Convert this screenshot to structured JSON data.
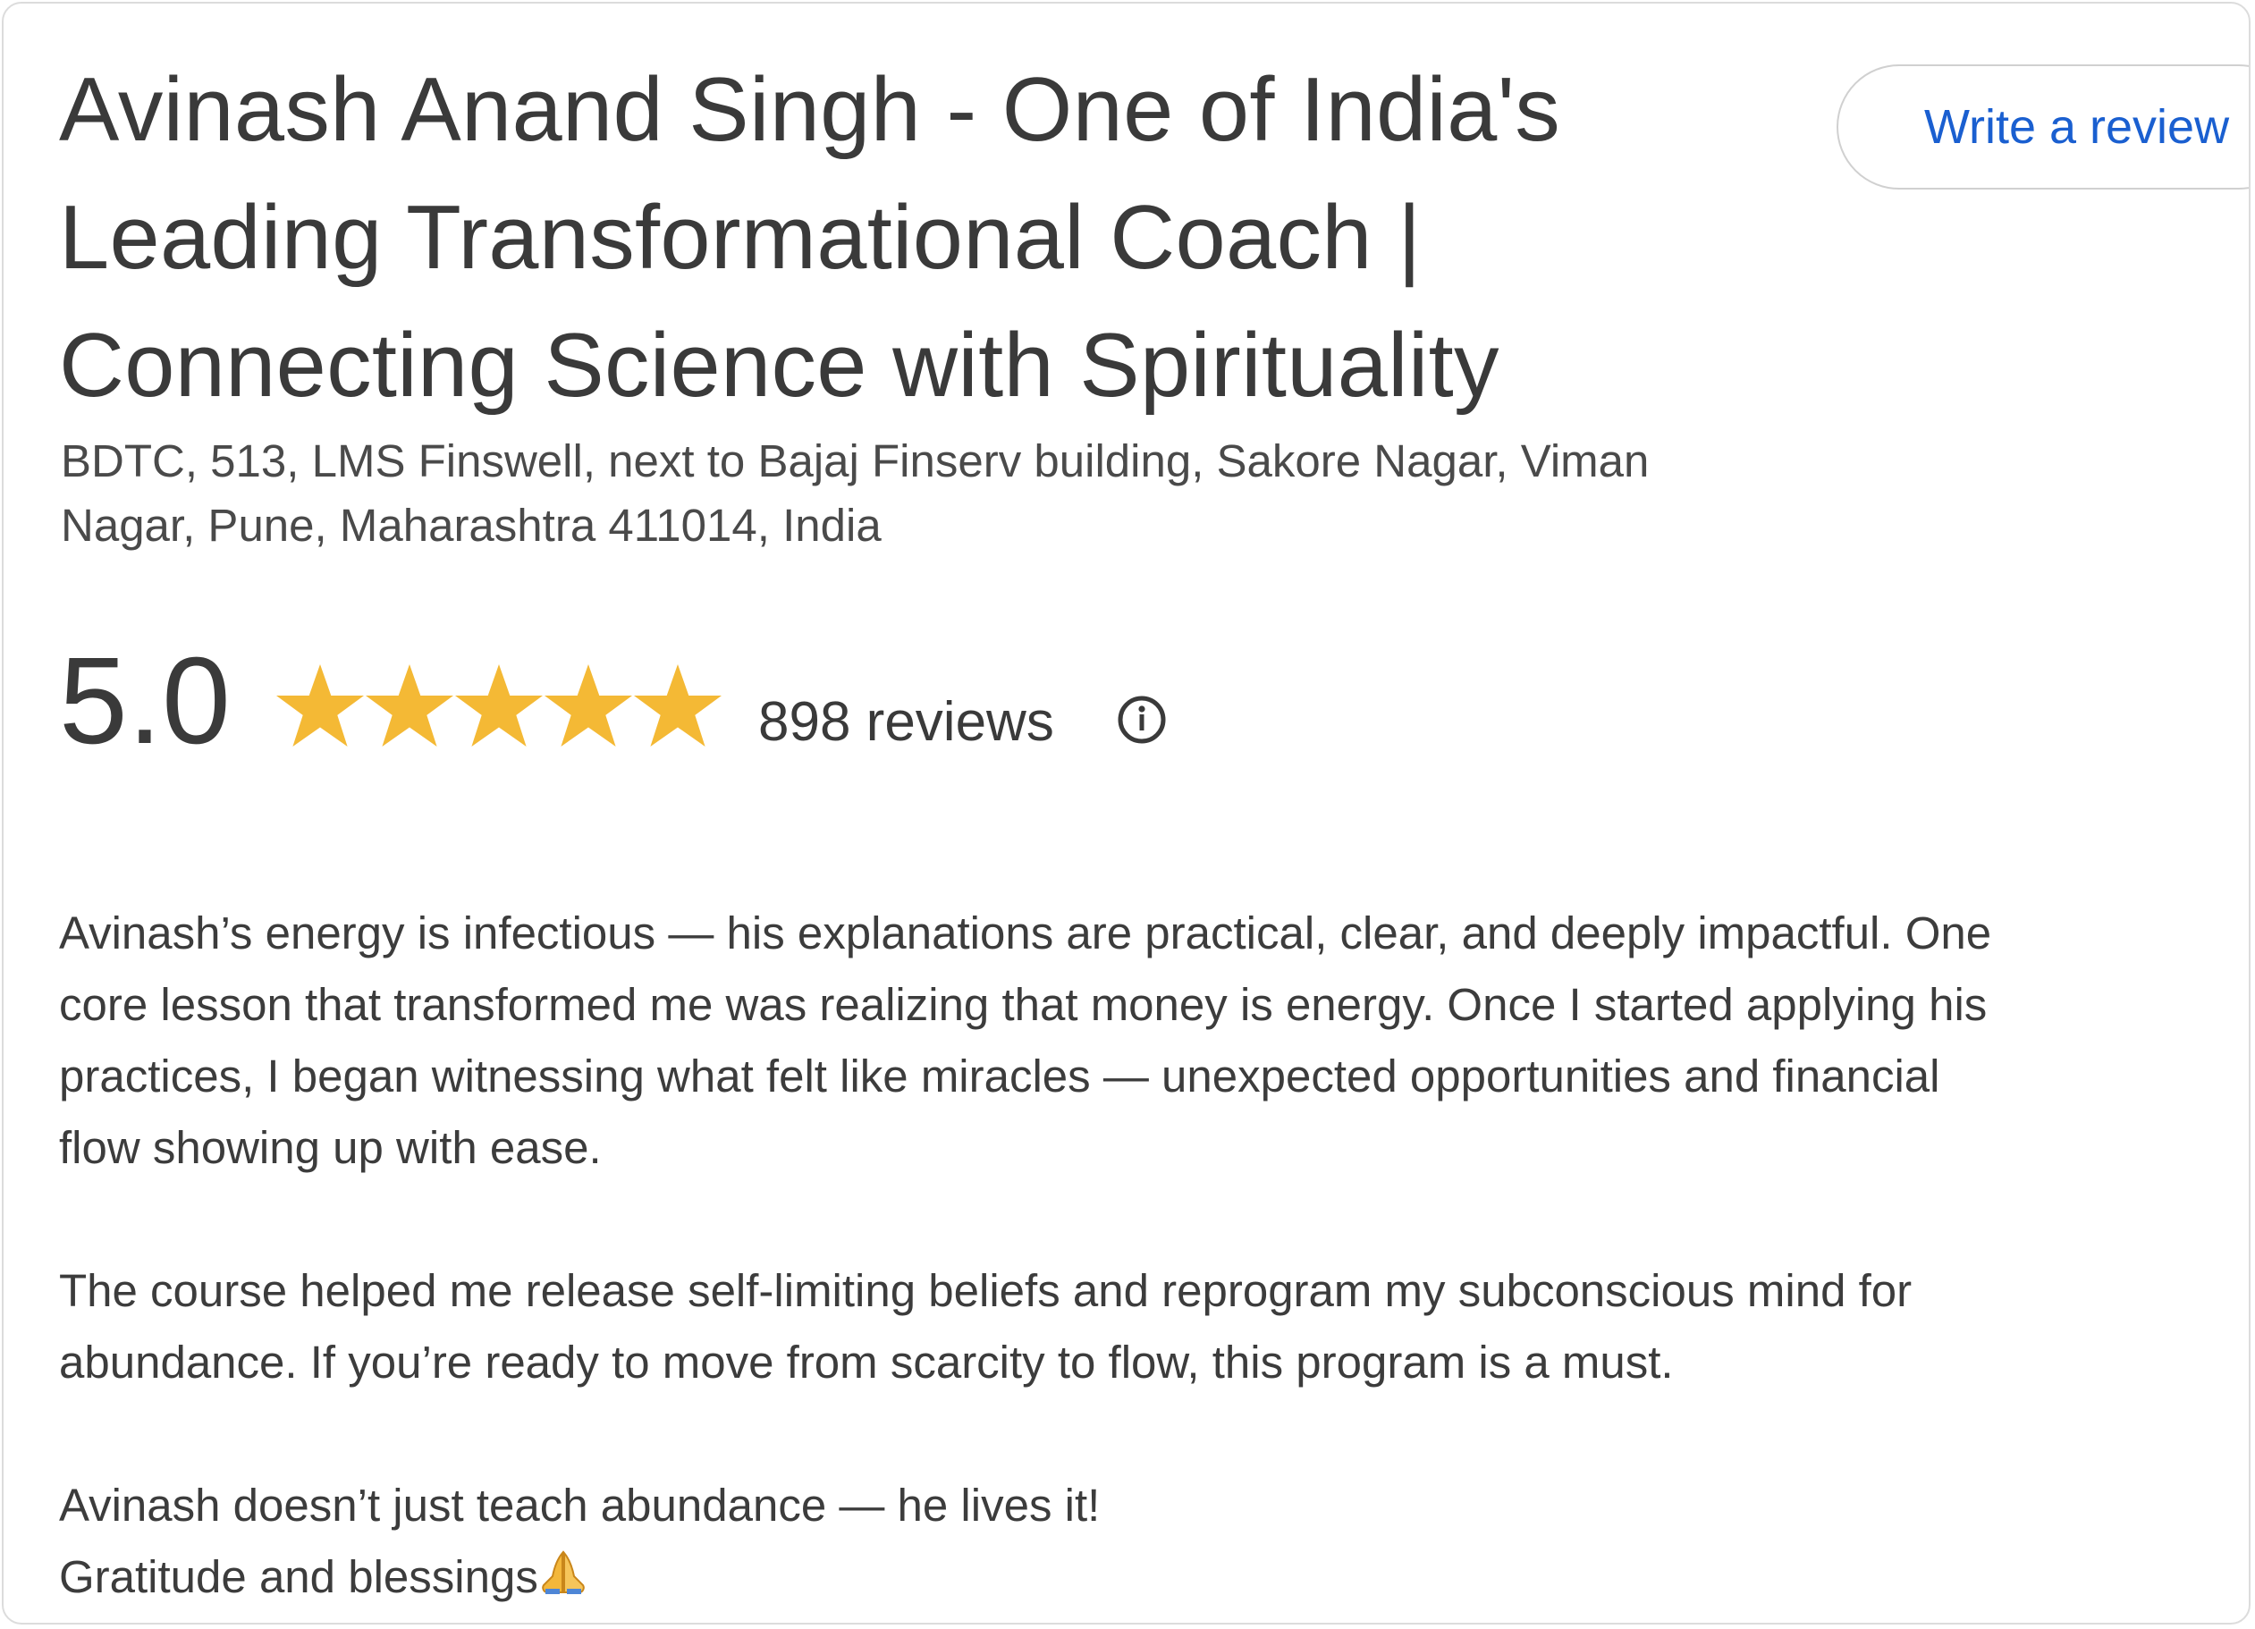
{
  "place": {
    "title_lines": [
      "Avinash Anand Singh - One of India's",
      "Leading Transformational Coach |",
      "Connecting Science with Spirituality"
    ],
    "address_lines": [
      "BDTC, 513, LMS Finswell, next to Bajaj Finserv building, Sakore Nagar, Viman",
      "Nagar, Pune, Maharashtra 411014, India"
    ]
  },
  "actions": {
    "write_review_label": "Write a review"
  },
  "rating": {
    "value": "5.0",
    "stars_filled": 5,
    "stars_total": 5,
    "reviews_label": "898 reviews",
    "info_icon": "info-circle-icon",
    "star_color": "#f4b935"
  },
  "review": {
    "paragraph_1_lines": [
      "Avinash’s energy is infectious — his explanations are practical, clear, and deeply impactful. One",
      "core lesson that transformed me was realizing that money is energy. Once I started applying his",
      "practices, I began witnessing what felt like miracles — unexpected opportunities and financial",
      "flow showing up with ease."
    ],
    "paragraph_2_lines": [
      "The course helped me release self-limiting beliefs and reprogram my subconscious mind for",
      "abundance. If you’re ready to move from scarcity to flow, this program is a must."
    ],
    "closing_line": "Avinash doesn’t just teach abundance — he lives it!",
    "signoff": "Gratitude and blessings",
    "signoff_emoji": "folded-hands-icon"
  },
  "colors": {
    "link": "#1a5fd0",
    "text": "#3c3c3c",
    "border": "#dcdcdc"
  }
}
